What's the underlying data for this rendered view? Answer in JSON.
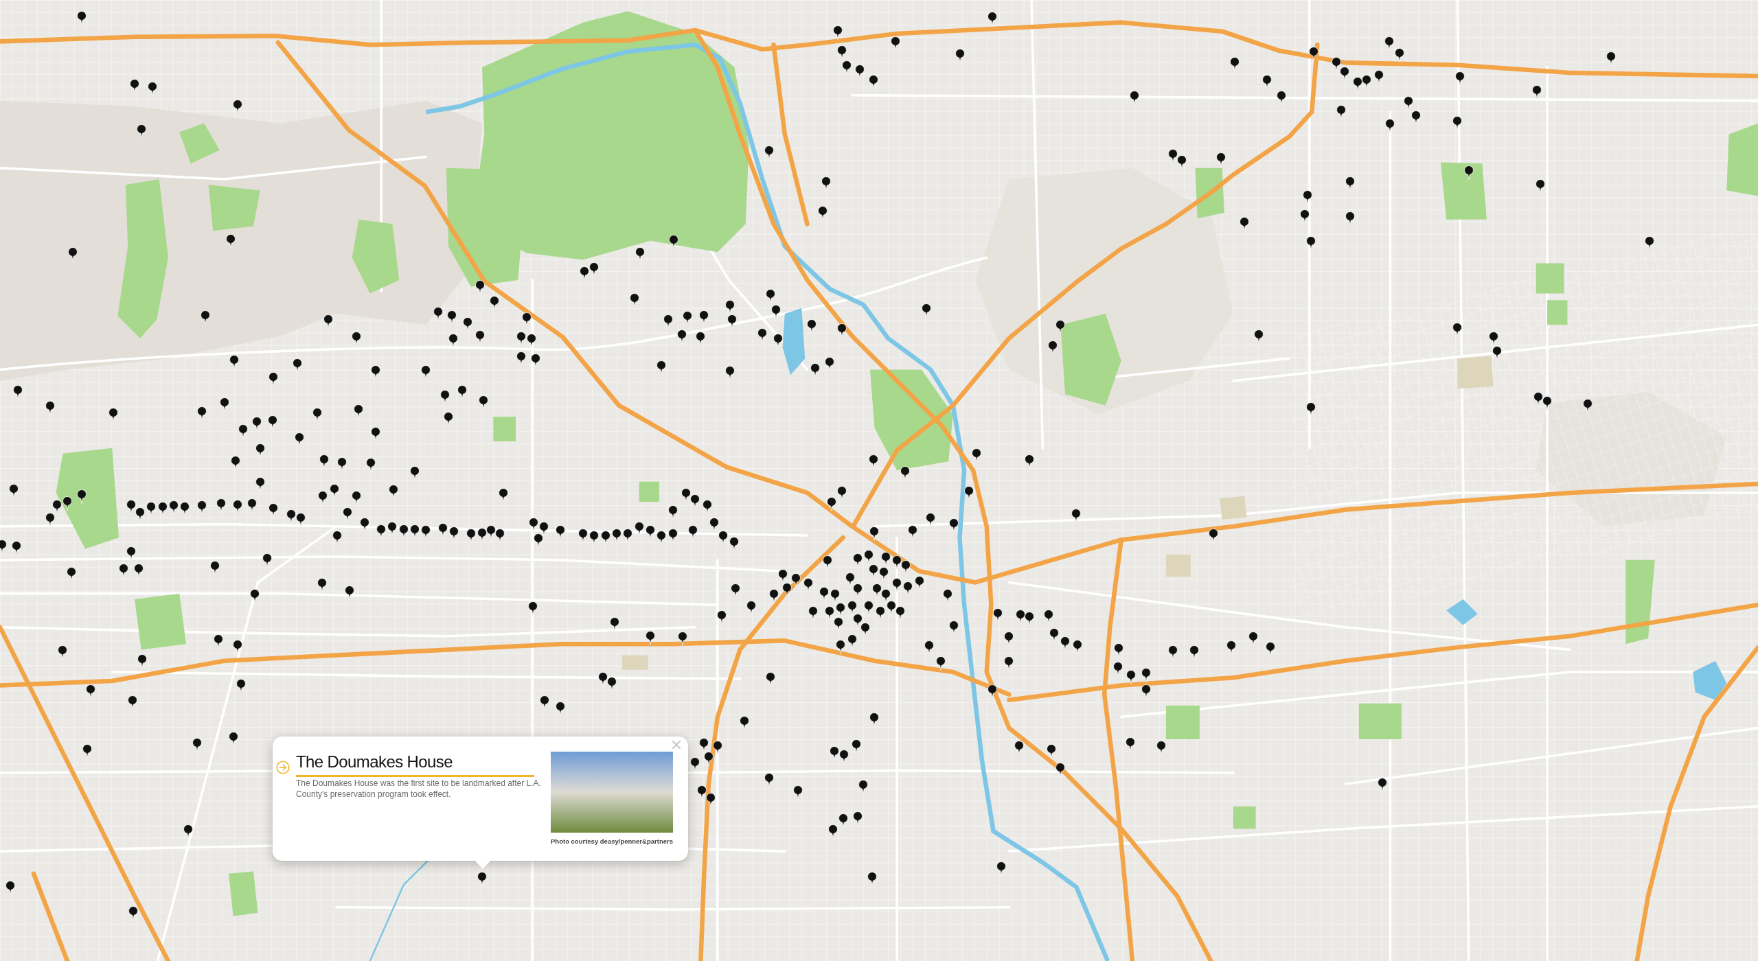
{
  "popup": {
    "title": "The Doumakes House",
    "description": "The Doumakes House was the first site to be landmarked after L.A. County's preservation program took effect.",
    "photo_caption": "Photo courtesy deasy/penner&partners"
  }
}
